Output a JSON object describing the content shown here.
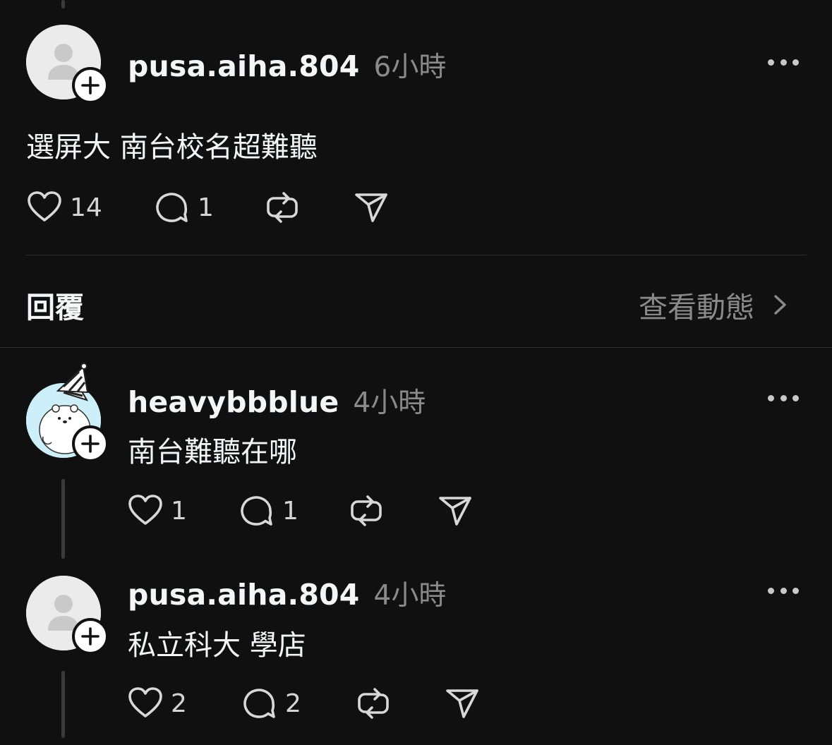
{
  "main_post": {
    "username": "pusa.aiha.804",
    "time": "6小時",
    "text": "選屏大 南台校名超難聽",
    "likes": "14",
    "comments": "1"
  },
  "replies_header": {
    "label": "回覆",
    "view_activity": "查看動態"
  },
  "replies": [
    {
      "username": "heavybbblue",
      "time": "4小時",
      "text": "南台難聽在哪",
      "likes": "1",
      "comments": "1"
    },
    {
      "username": "pusa.aiha.804",
      "time": "4小時",
      "text": "私立科大 學店",
      "likes": "2",
      "comments": "2"
    }
  ],
  "colors": {
    "background": "#101010",
    "text": "#f3f5f7",
    "muted": "#8a8a8a",
    "divider": "#2e2e2e"
  },
  "icons": [
    "heart-icon",
    "comment-icon",
    "repost-icon",
    "share-icon",
    "more-icon",
    "plus-icon",
    "chevron-right-icon"
  ]
}
